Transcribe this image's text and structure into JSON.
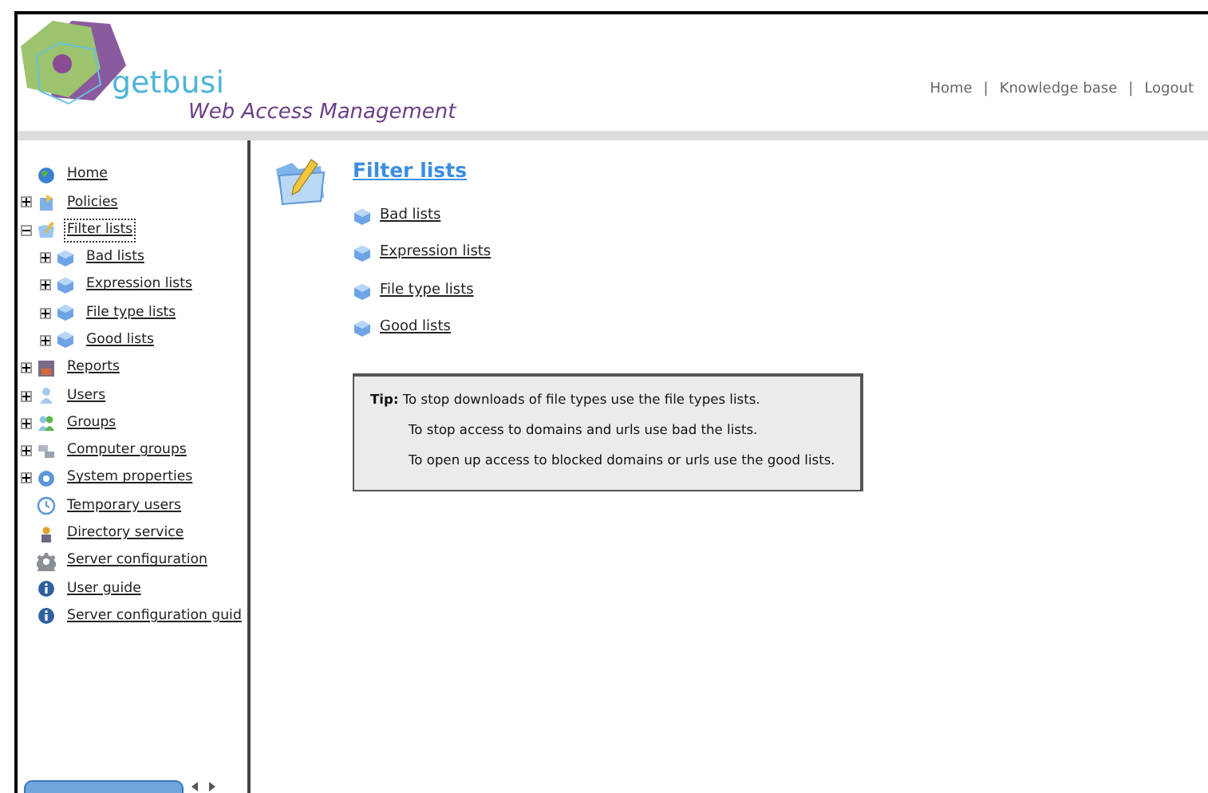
{
  "header": {
    "logo_text": "getbusi",
    "subtitle": "Web Access Management",
    "links": [
      "Home",
      "Knowledge base",
      "Logout"
    ],
    "separator": "|"
  },
  "sidebar": {
    "items": [
      {
        "label": "Home",
        "selected": false
      },
      {
        "label": "Policies",
        "expanded": false,
        "selected": false
      },
      {
        "label": "Filter lists",
        "expanded": true,
        "selected": true,
        "children": [
          {
            "label": "Bad lists",
            "expanded": false,
            "selected": false
          },
          {
            "label": "Expression lists",
            "expanded": false,
            "selected": false
          },
          {
            "label": "File type lists",
            "expanded": false,
            "selected": false
          },
          {
            "label": "Good lists",
            "expanded": false,
            "selected": false
          }
        ]
      },
      {
        "label": "Reports",
        "expanded": false,
        "selected": false
      },
      {
        "label": "Users",
        "expanded": false,
        "selected": false
      },
      {
        "label": "Groups",
        "expanded": false,
        "selected": false
      },
      {
        "label": "Computer groups",
        "expanded": false,
        "selected": false
      },
      {
        "label": "System properties",
        "expanded": false,
        "selected": false
      },
      {
        "label": "Temporary users",
        "selected": false
      },
      {
        "label": "Directory service",
        "selected": false
      },
      {
        "label": "Server configuration",
        "selected": false
      },
      {
        "label": "User guide",
        "selected": false
      },
      {
        "label": "Server configuration guid",
        "selected": false
      }
    ]
  },
  "content": {
    "title": "Filter lists",
    "links": [
      "Bad lists",
      "Expression lists",
      "File type lists",
      "Good lists"
    ],
    "tip": {
      "label": "Tip:",
      "lines": [
        "To stop downloads of file types use the file types lists.",
        "To stop access to domains and urls use bad the lists.",
        "To open up access to blocked domains or urls use the good lists."
      ]
    }
  }
}
